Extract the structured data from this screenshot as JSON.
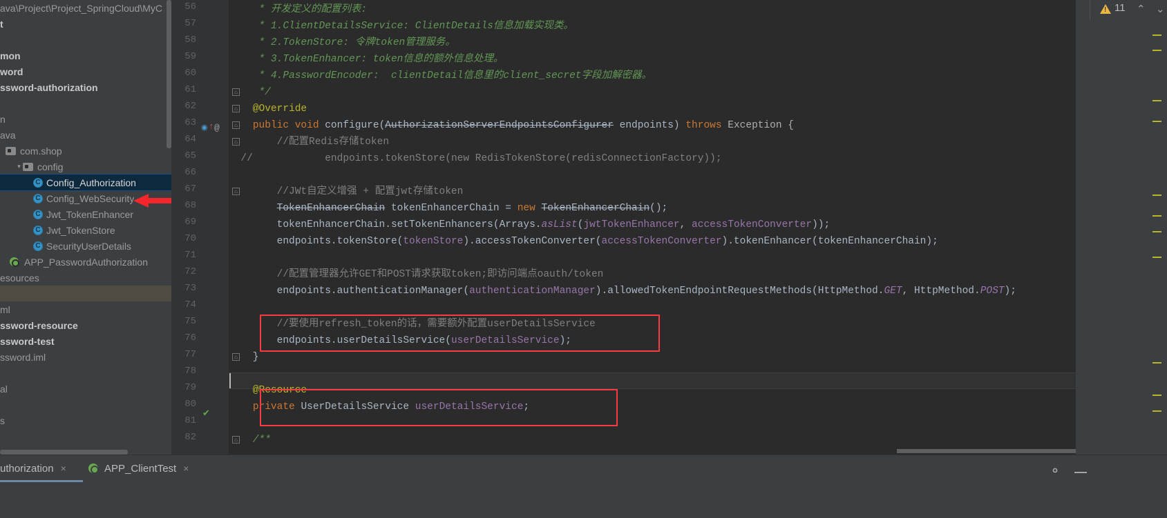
{
  "window": {
    "path_crumb": "ava\\Project\\Project_SpringCloud\\MyC"
  },
  "sidebar": {
    "items": [
      {
        "label": "t",
        "style": "bold",
        "indent": 0,
        "icon": "none"
      },
      {
        "label": "",
        "style": "dim",
        "indent": 0,
        "icon": "none"
      },
      {
        "label": "mon",
        "style": "bold",
        "indent": 0,
        "icon": "none"
      },
      {
        "label": "word",
        "style": "bold",
        "indent": 0,
        "icon": "none"
      },
      {
        "label": "ssword-authorization",
        "style": "bold",
        "indent": 0,
        "icon": "none"
      },
      {
        "label": "",
        "style": "dim",
        "indent": 0,
        "icon": "none"
      },
      {
        "label": "n",
        "style": "dim",
        "indent": 0,
        "icon": "none"
      },
      {
        "label": "ava",
        "style": "dim",
        "indent": 0,
        "icon": "none"
      },
      {
        "label": "com.shop",
        "style": "dim",
        "indent": 8,
        "icon": "folder"
      },
      {
        "label": "config",
        "style": "dim",
        "indent": 22,
        "icon": "folder",
        "caret": "▾"
      },
      {
        "label": "Config_Authorization",
        "style": "selected",
        "indent": 48,
        "icon": "class"
      },
      {
        "label": "Config_WebSecurity",
        "style": "dim",
        "indent": 48,
        "icon": "class"
      },
      {
        "label": "Jwt_TokenEnhancer",
        "style": "dim",
        "indent": 48,
        "icon": "class"
      },
      {
        "label": "Jwt_TokenStore",
        "style": "dim",
        "indent": 48,
        "icon": "class"
      },
      {
        "label": "SecurityUserDetails",
        "style": "dim",
        "indent": 48,
        "icon": "class"
      },
      {
        "label": "APP_PasswordAuthorization",
        "style": "dim",
        "indent": 14,
        "icon": "springapp"
      },
      {
        "label": "esources",
        "style": "dim",
        "indent": 0,
        "icon": "none"
      },
      {
        "label": "",
        "style": "band",
        "indent": 0,
        "icon": "none"
      },
      {
        "label": "ml",
        "style": "dim",
        "indent": 0,
        "icon": "none"
      },
      {
        "label": "ssword-resource",
        "style": "bold",
        "indent": 0,
        "icon": "none"
      },
      {
        "label": "ssword-test",
        "style": "bold",
        "indent": 0,
        "icon": "none"
      },
      {
        "label": "ssword.iml",
        "style": "dim",
        "indent": 0,
        "icon": "none"
      },
      {
        "label": "",
        "style": "dim",
        "indent": 0,
        "icon": "none"
      },
      {
        "label": "al",
        "style": "dim",
        "indent": 0,
        "icon": "none"
      },
      {
        "label": "",
        "style": "dim",
        "indent": 0,
        "icon": "none"
      },
      {
        "label": "s",
        "style": "dim",
        "indent": 0,
        "icon": "none"
      }
    ]
  },
  "inspections": {
    "warning_count": "11",
    "up_chevron": "⌃",
    "down_chevron": "⌄"
  },
  "editor": {
    "first_line_number": 56,
    "lines": [
      {
        "n": 56,
        "segments": [
          {
            "t": "     * ",
            "c": "c-jdoc"
          },
          {
            "t": "开发定义的配置列表:",
            "c": "c-jdoc"
          }
        ]
      },
      {
        "n": 57,
        "segments": [
          {
            "t": "     * 1.ClientDetailsService: ClientDetails信息加载实现类。",
            "c": "c-jdoc"
          }
        ]
      },
      {
        "n": 58,
        "segments": [
          {
            "t": "     * 2.TokenStore: 令牌token管理服务。",
            "c": "c-jdoc"
          }
        ]
      },
      {
        "n": 59,
        "segments": [
          {
            "t": "     * 3.TokenEnhancer: token信息的额外信息处理。",
            "c": "c-jdoc"
          }
        ]
      },
      {
        "n": 60,
        "segments": [
          {
            "t": "     * 4.PasswordEncoder:  clientDetail信息里的client_secret字段加解密器。",
            "c": "c-jdoc"
          }
        ]
      },
      {
        "n": 61,
        "segments": [
          {
            "t": "     */",
            "c": "c-jdoc"
          }
        ]
      },
      {
        "n": 62,
        "segments": [
          {
            "t": "    @Override",
            "c": "c-anno"
          }
        ]
      },
      {
        "n": 63,
        "segments": [
          {
            "t": "    ",
            "c": "c-plain"
          },
          {
            "t": "public void ",
            "c": "c-kw"
          },
          {
            "t": "configure",
            "c": "c-plain"
          },
          {
            "t": "(",
            "c": "c-plain"
          },
          {
            "t": "AuthorizationServerEndpointsConfigurer",
            "c": "c-strike"
          },
          {
            "t": " endpoints) ",
            "c": "c-plain"
          },
          {
            "t": "throws ",
            "c": "c-kw"
          },
          {
            "t": "Exception {",
            "c": "c-gray"
          }
        ]
      },
      {
        "n": 64,
        "segments": [
          {
            "t": "        //配置Redis存储token",
            "c": "c-comment"
          }
        ]
      },
      {
        "n": 65,
        "segments": [
          {
            "t": "            endpoints.tokenStore(new RedisTokenStore(redisConnectionFactory));",
            "c": "c-comment"
          }
        ],
        "commented": true
      },
      {
        "n": 66,
        "segments": []
      },
      {
        "n": 67,
        "segments": [
          {
            "t": "        //JWt自定义增强 + 配置jwt存储token",
            "c": "c-comment"
          }
        ]
      },
      {
        "n": 68,
        "segments": [
          {
            "t": "        ",
            "c": "c-plain"
          },
          {
            "t": "TokenEnhancerChain",
            "c": "c-strike"
          },
          {
            "t": " tokenEnhancerChain = ",
            "c": "c-plain"
          },
          {
            "t": "new ",
            "c": "c-kw"
          },
          {
            "t": "TokenEnhancerChain",
            "c": "c-strike"
          },
          {
            "t": "();",
            "c": "c-plain"
          }
        ]
      },
      {
        "n": 69,
        "segments": [
          {
            "t": "        tokenEnhancerChain.setTokenEnhancers(Arrays.",
            "c": "c-plain"
          },
          {
            "t": "asList",
            "c": "c-static"
          },
          {
            "t": "(",
            "c": "c-plain"
          },
          {
            "t": "jwtTokenEnhancer",
            "c": "c-field"
          },
          {
            "t": ", ",
            "c": "c-plain"
          },
          {
            "t": "accessTokenConverter",
            "c": "c-field"
          },
          {
            "t": "));",
            "c": "c-plain"
          }
        ]
      },
      {
        "n": 70,
        "segments": [
          {
            "t": "        endpoints.tokenStore(",
            "c": "c-plain"
          },
          {
            "t": "tokenStore",
            "c": "c-field"
          },
          {
            "t": ").accessTokenConverter(",
            "c": "c-plain"
          },
          {
            "t": "accessTokenConverter",
            "c": "c-field"
          },
          {
            "t": ").tokenEnhancer(tokenEnhancerChain);",
            "c": "c-plain"
          }
        ]
      },
      {
        "n": 71,
        "segments": []
      },
      {
        "n": 72,
        "segments": [
          {
            "t": "        //配置管理器允许GET和POST请求获取token;即访问端点oauth/token",
            "c": "c-comment"
          }
        ]
      },
      {
        "n": 73,
        "segments": [
          {
            "t": "        endpoints.authenticationManager(",
            "c": "c-plain"
          },
          {
            "t": "authenticationManager",
            "c": "c-field"
          },
          {
            "t": ").allowedTokenEndpointRequestMethods(HttpMethod.",
            "c": "c-plain"
          },
          {
            "t": "GET",
            "c": "c-static"
          },
          {
            "t": ", HttpMethod.",
            "c": "c-plain"
          },
          {
            "t": "POST",
            "c": "c-static"
          },
          {
            "t": ");",
            "c": "c-plain"
          }
        ]
      },
      {
        "n": 74,
        "segments": []
      },
      {
        "n": 75,
        "segments": [
          {
            "t": "        //要使用refresh_token的话，需要额外配置userDetailsService",
            "c": "c-comment"
          }
        ]
      },
      {
        "n": 76,
        "segments": [
          {
            "t": "        endpoints.userDetailsService(",
            "c": "c-plain"
          },
          {
            "t": "userDetailsService",
            "c": "c-field"
          },
          {
            "t": ");",
            "c": "c-plain"
          }
        ]
      },
      {
        "n": 77,
        "segments": [
          {
            "t": "    }",
            "c": "c-plain"
          }
        ]
      },
      {
        "n": 78,
        "segments": []
      },
      {
        "n": 79,
        "segments": [
          {
            "t": "    @Resource",
            "c": "c-anno"
          }
        ]
      },
      {
        "n": 80,
        "segments": [
          {
            "t": "    ",
            "c": "c-plain"
          },
          {
            "t": "private ",
            "c": "c-kw"
          },
          {
            "t": "UserDetailsService ",
            "c": "c-plain"
          },
          {
            "t": "userDetailsService",
            "c": "c-field"
          },
          {
            "t": ";",
            "c": "c-plain"
          }
        ]
      },
      {
        "n": 81,
        "segments": []
      },
      {
        "n": 82,
        "segments": [
          {
            "t": "    /**",
            "c": "c-jdoc"
          }
        ]
      }
    ]
  },
  "tabs": [
    {
      "label": "uthorization",
      "active": true,
      "close": "×",
      "icon": "none"
    },
    {
      "label": "APP_ClientTest",
      "active": false,
      "close": "×",
      "icon": "spring"
    }
  ],
  "statusbar": {
    "gear": "gear-icon",
    "minimize": "minimize-icon"
  },
  "colors": {
    "editor_bg": "#2b2b2b",
    "panel_bg": "#3c3f41",
    "gutter_bg": "#313335",
    "selection_bg": "#0d293e",
    "annotation_red": "#fb3b40",
    "keyword": "#cc7832",
    "comment": "#808080",
    "javadoc": "#629755",
    "field": "#9876aa",
    "annotation_yellow": "#bbb529",
    "warning_yellow": "#edb641"
  }
}
